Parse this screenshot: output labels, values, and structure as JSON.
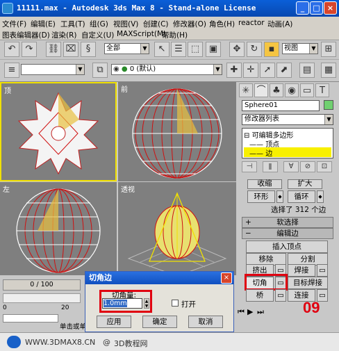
{
  "window": {
    "title": "11111.max - Autodesk 3ds Max 8 - Stand-alone License",
    "minimize": "_",
    "maximize": "□",
    "close": "×"
  },
  "menu": {
    "row1": [
      "文件(F)",
      "编辑(E)",
      "工具(T)",
      "组(G)",
      "视图(V)",
      "创建(C)",
      "修改器(O)",
      "角色(H)",
      "reactor",
      "动画(A)"
    ],
    "row2": [
      "图表编辑器(D)",
      "渲染(R)",
      "自定义(U)",
      "MAXScript(M)",
      "帮助(H)"
    ]
  },
  "toolbar1": {
    "selection_filter": "全部",
    "view_dropdown": "视图"
  },
  "toolbar2": {
    "layer_label": "0 (默认)"
  },
  "viewports": {
    "top": "顶",
    "front": "前",
    "left": "左",
    "perspective": "透视"
  },
  "command_panel": {
    "object_name": "Sphere01",
    "modifier_list": "修改器列表",
    "stack_root": "可编辑多边形",
    "stack_vertex": "顶点",
    "stack_edge": "边",
    "partial_top_left": "收缩",
    "partial_top_right": "扩大",
    "ring_button": "环形",
    "loop_button": "循环",
    "selection_status": "选择了 312 个边",
    "soft_selection": "软选择",
    "edit_edges": "编辑边",
    "insert_vertex": "插入顶点",
    "remove": "移除",
    "split": "分割",
    "extrude": "挤出",
    "weld": "焊接",
    "chamfer": "切角",
    "target_weld": "目标焊接",
    "bridge": "桥",
    "connect": "连接"
  },
  "dialog": {
    "title": "切角边",
    "amount_label": "切角量:",
    "amount_value": "1.0mm",
    "open_checkbox": "打开",
    "apply": "应用",
    "ok": "确定",
    "cancel": "取消"
  },
  "timeline": {
    "frame": "0 / 100",
    "tick_0": "0",
    "tick_20": "20"
  },
  "status": {
    "prompt": "单击或单",
    "step_number": "09"
  },
  "footer": {
    "site1": "WWW.3DMAX8.CN",
    "separator": "@",
    "site2": "3D教程网"
  },
  "colors": {
    "title_bar": "#0a5fd8",
    "viewport_bg": "#7f7f7f",
    "active_viewport": "#f0e000",
    "selected_edges": "#d01010",
    "highlight_red": "#e00010",
    "stack_selected": "#f8f000"
  }
}
